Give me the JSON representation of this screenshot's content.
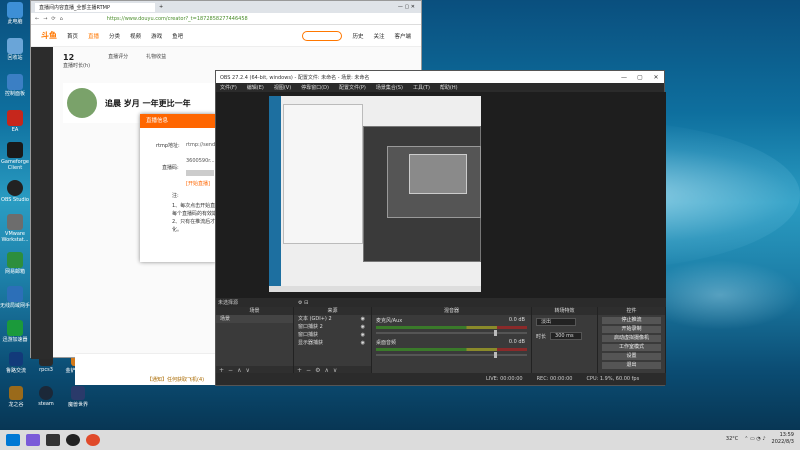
{
  "desktop": {
    "icons": [
      {
        "label": "此电脑",
        "color": "#3d8fd6"
      },
      {
        "label": "回收站",
        "color": "#6aa5d8"
      },
      {
        "label": "控制面板",
        "color": "#3b7fc4"
      },
      {
        "label": "EA",
        "color": "#c6271c"
      },
      {
        "label": "Gameforge Client",
        "color": "#1a1a1a"
      },
      {
        "label": "OBS Studio",
        "color": "#222"
      },
      {
        "label": "VMware Workstat...",
        "color": "#6d6d6d"
      },
      {
        "label": "网易邮箱",
        "color": "#2d8e3d"
      },
      {
        "label": "无线局域网手",
        "color": "#2c6fb8"
      },
      {
        "label": "迅游加速器",
        "color": "#1b9a3b"
      }
    ],
    "bottom_icons": [
      {
        "label": "鲁路交流",
        "color": "#123a7a"
      },
      {
        "label": "rpcs3",
        "color": "#2a2a2a"
      },
      {
        "label": "金铲铲助手",
        "color": "#d47a1a"
      },
      {
        "label": "龙之谷",
        "color": "#9a6a1a"
      },
      {
        "label": "steam",
        "color": "#1b2838"
      },
      {
        "label": "魔兽世界",
        "color": "#2a3a6a"
      }
    ]
  },
  "browser": {
    "tab_title": "直播间内容直播_全部主播RTMP",
    "url": "https://www.douyu.com/creator?_t=1872858277446458",
    "nav": {
      "logo": "斗鱼",
      "items": [
        "首页",
        "直播",
        "分类",
        "视频",
        "游戏",
        "鱼吧"
      ],
      "active": "直播",
      "extras": [
        "历史",
        "关注",
        "客户端"
      ]
    },
    "stats": [
      {
        "value": "12",
        "label": "直播时长(h)"
      },
      {
        "value": "",
        "label": "直播评分"
      },
      {
        "value": "",
        "label": "礼物收益"
      }
    ],
    "room_name": "追晨 岁月 一年更比一年",
    "modal": {
      "title": "直播信息",
      "rtmp_label": "rtmp地址:",
      "rtmp_value": "rtmp://sendtc...",
      "code_label": "直播码:",
      "code_value": "3600590r...",
      "warn": "[开始直播]",
      "note_title": "注:",
      "note_1": "1、每次点击开始直播",
      "note_2": "每个直播码的有效期",
      "note_3": "2、只有在推流后才可",
      "note_4": "化。"
    },
    "announcement": "【通知】任何获取飞机(4)"
  },
  "obs": {
    "title": "OBS 27.2.4 (64-bit, windows) - 配置文件: 未命名 - 场景: 未命名",
    "menu": [
      "文件(F)",
      "编辑(E)",
      "视图(V)",
      "停靠窗口(D)",
      "配置文件(P)",
      "场景集合(S)",
      "工具(T)",
      "帮助(H)"
    ],
    "source_bar": "未选择源",
    "scenes": {
      "title": "场景",
      "items": [
        "场景"
      ]
    },
    "sources": {
      "title": "来源",
      "items": [
        "文本 (GDI+) 2",
        "窗口捕获 2",
        "窗口捕获",
        "显示器捕获"
      ]
    },
    "mixer": {
      "title": "混音器",
      "rows": [
        {
          "name": "麦克风/Aux",
          "db": "0.0 dB"
        },
        {
          "name": "桌面音频",
          "db": "0.0 dB"
        }
      ]
    },
    "transitions": {
      "title": "转场特效",
      "type": "淡出",
      "duration_label": "时长",
      "duration_value": "300 ms"
    },
    "controls": {
      "title": "控件",
      "buttons": [
        "停止推流",
        "开始录制",
        "启动虚拟摄像机",
        "工作室模式",
        "设置",
        "退出"
      ]
    },
    "status": [
      "LIVE: 00:00:00",
      "REC: 00:00:00",
      "CPU: 1.9%, 60.00 fps"
    ]
  },
  "taskbar": {
    "temp": "32°C",
    "time": "13:59",
    "date": "2022/8/3"
  }
}
